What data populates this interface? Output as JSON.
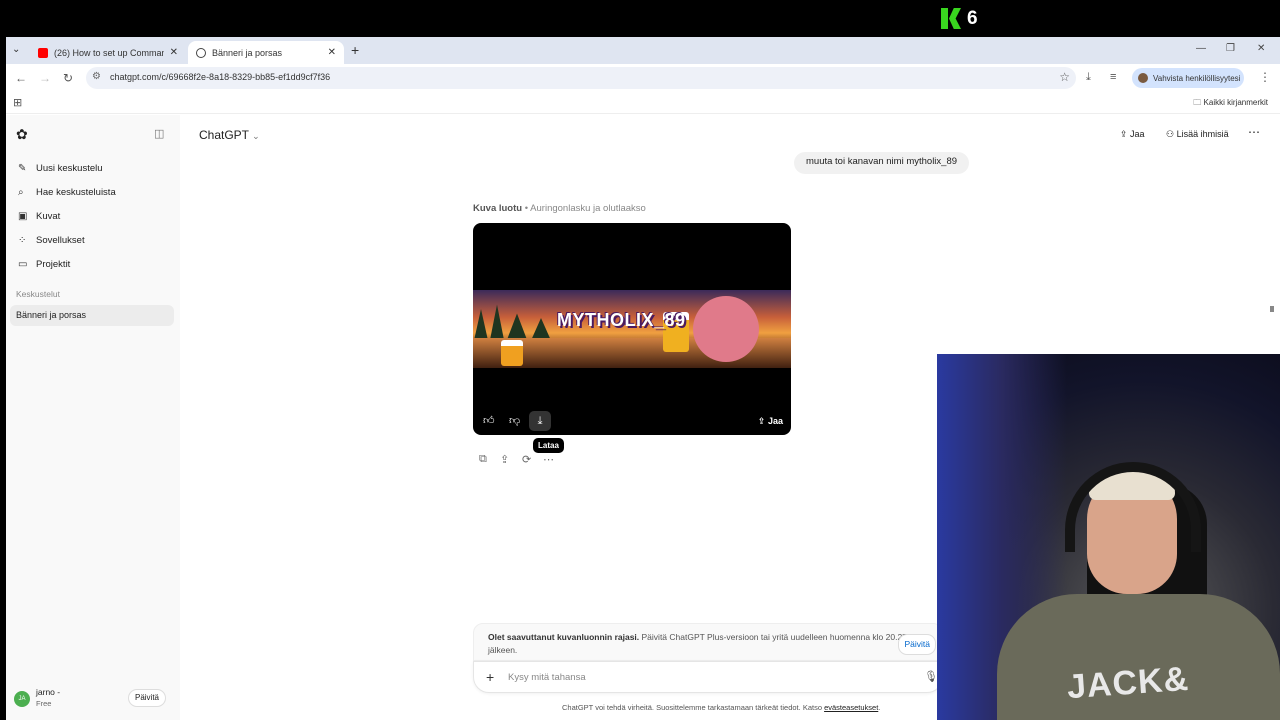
{
  "overlay": {
    "stream_logo": "K",
    "stream_count": "6"
  },
  "browser": {
    "tabs": [
      {
        "title": "(26) How to set up Commands",
        "favicon_color": "#ff0000"
      },
      {
        "title": "Bänneri ja porsas",
        "favicon_color": "#444444"
      }
    ],
    "url": "chatgpt.com/c/69668f2e-8a18-8329-bb85-ef1dd9cf7f36",
    "profile_chip": "Vahvista henkilöllisyytesi",
    "bookmarks_all": "Kaikki kirjanmerkit"
  },
  "sidebar": {
    "items": [
      {
        "icon": "edit-icon",
        "label": "Uusi keskustelu"
      },
      {
        "icon": "search-icon",
        "label": "Hae keskusteluista"
      },
      {
        "icon": "image-icon",
        "label": "Kuvat"
      },
      {
        "icon": "apps-icon",
        "label": "Sovellukset"
      },
      {
        "icon": "folder-icon",
        "label": "Projektit"
      }
    ],
    "section_title": "Keskustelut",
    "active_chat": "Bänneri ja porsas",
    "user_name": "jarno -",
    "user_plan": "Free",
    "user_initials": "JA",
    "upgrade_label": "Päivitä"
  },
  "header": {
    "model": "ChatGPT",
    "share_label": "Jaa",
    "add_people_label": "Lisää ihmisiä"
  },
  "chat": {
    "user_message": "muuta toi kanavan nimi mytholix_89",
    "image_caption_bold": "Kuva luotu",
    "image_caption": " • Auringonlasku ja olutlaakso",
    "banner_text": "MYTHOLIX_89",
    "image_share_label": "Jaa",
    "download_tooltip": "Lataa"
  },
  "limit_notice": {
    "bold": "Olet saavuttanut kuvanluonnin rajasi.",
    "text": " Päivitä ChatGPT Plus-versioon tai yritä uudelleen huomenna klo 20.27 jälkeen.",
    "button": "Päivitä"
  },
  "composer": {
    "placeholder": "Kysy mitä tahansa"
  },
  "footer": {
    "text": "ChatGPT voi tehdä virheitä. Suosittelemme tarkastamaan tärkeät tiedot. Katso ",
    "link": "evästeasetukset",
    "end": "."
  },
  "webcam": {
    "shirt_text": "JACK&"
  }
}
